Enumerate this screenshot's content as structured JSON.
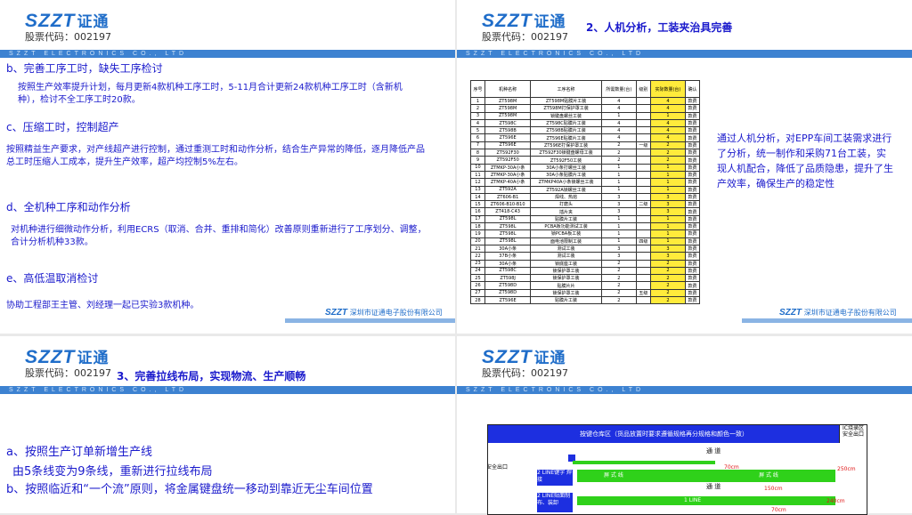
{
  "logo_text": "SZZT",
  "logo_cn": "证通",
  "stock_code": "股票代码：002197",
  "band_text": "SZZT ELECTRONICS CO., LTD",
  "footer_logo": "SZZT",
  "footer_logo_cn": "深圳市证通电子股份有限公司",
  "slide1": {
    "b_head": "b、完善工序工时，缺失工序检讨",
    "b_body": "按照生产效率提升计划，每月更新4款机种工序工时，5-11月合计更新24款机种工序工时（含新机种），检讨不全工序工时20款。",
    "c_head": "c、压缩工时，控制超产",
    "c_body": "按照精益生产要求，对产线超产进行控制，通过重测工时和动作分析，结合生产异常的降低，逐月降低产品总工时压缩人工成本，提升生产效率，超产均控制5%左右。",
    "d_head": "d、全机种工序和动作分析",
    "d_body": "对机种进行细微动作分析，利用ECRS（取消、合并、重排和简化）改善原则重新进行了工序划分、调整，合计分析机种33款。",
    "e_head": "e、高低温取消检讨",
    "e_body": "协助工程部王主管、刘经理一起已实验3款机种。"
  },
  "slide2": {
    "title": "2、人机分析，工装夹治具完善",
    "summary": "通过人机分析，对EPP车间工装需求进行了分析，统一制作和采购71台工装，实现人机配合，降低了品质隐患，提升了生产效率，确保生产的稳定性",
    "table_headers": [
      "序号",
      "机种名称",
      "工序名称",
      "所需数量(台)",
      "级别",
      "实际数量(台)",
      "确认"
    ],
    "rows": [
      [
        "1",
        "ZT598M",
        "ZT598M贴膜片工装",
        "4",
        "",
        "4",
        "款费"
      ],
      [
        "2",
        "ZT598M",
        "ZT598M打保护罩工装",
        "4",
        "",
        "4",
        "款费"
      ],
      [
        "3",
        "ZT598M",
        "锁键盘螺丝工装",
        "1",
        "",
        "1",
        "款费"
      ],
      [
        "4",
        "ZT598C",
        "ZT598C贴膜片工装",
        "4",
        "",
        "4",
        "款费"
      ],
      [
        "5",
        "ZT598B",
        "ZT598B贴膜片工装",
        "4",
        "",
        "4",
        "款费"
      ],
      [
        "6",
        "ZT596E",
        "ZT596E贴膜片工装",
        "4",
        "",
        "4",
        "款费"
      ],
      [
        "7",
        "ZT596E",
        "ZT596E打保护罩工装",
        "2",
        "一级",
        "2",
        "款费"
      ],
      [
        "8",
        "ZT592F30",
        "ZT592F30锁键盘螺母工装",
        "2",
        "",
        "2",
        "款费"
      ],
      [
        "9",
        "ZT592F50",
        "ZT592F50工装",
        "2",
        "",
        "2",
        "款费"
      ],
      [
        "10",
        "ZTMKP-30A小条",
        "30A小条打螺丝工装",
        "1",
        "",
        "1",
        "款费"
      ],
      [
        "11",
        "ZTMKP-30A小条",
        "30A小条贴膜片工装",
        "1",
        "",
        "1",
        "款费"
      ],
      [
        "12",
        "ZTMKP-40A小条",
        "ZTMKP40A小条锁螺丝工装",
        "1",
        "",
        "1",
        "款费"
      ],
      [
        "13",
        "ZT592A",
        "ZT592A锁螺丝工装",
        "1",
        "",
        "1",
        "款费"
      ],
      [
        "14",
        "ZT606-B1",
        "焊线、热熔",
        "3",
        "",
        "3",
        "款费"
      ],
      [
        "15",
        "ZT606-B10-B10",
        "打磨头",
        "3",
        "二级",
        "3",
        "款费"
      ],
      [
        "16",
        "ZT418-C43",
        "插片夹",
        "3",
        "",
        "3",
        "款费"
      ],
      [
        "17",
        "ZT598L",
        "贴膜片工装",
        "1",
        "",
        "1",
        "款费"
      ],
      [
        "18",
        "ZT598L",
        "PCBA板功能测试工装",
        "1",
        "",
        "1",
        "款费"
      ],
      [
        "19",
        "ZT598L",
        "锁PCBA板工装",
        "1",
        "",
        "1",
        "款费"
      ],
      [
        "20",
        "ZT598L",
        "面电池限制工装",
        "1",
        "四级",
        "1",
        "款费"
      ],
      [
        "21",
        "30A小条",
        "测试工装",
        "3",
        "",
        "3",
        "款费"
      ],
      [
        "22",
        "37B小条",
        "测试工装",
        "3",
        "",
        "3",
        "款费"
      ],
      [
        "23",
        "30A小条",
        "锁底座工装",
        "2",
        "",
        "2",
        "款费"
      ],
      [
        "24",
        "ZT598C",
        "锁保护罩工装",
        "2",
        "",
        "2",
        "款费"
      ],
      [
        "25",
        "ZT598J",
        "锁保护罩工装",
        "2",
        "",
        "2",
        "款费"
      ],
      [
        "26",
        "ZT598D",
        "贴膜片片",
        "2",
        "",
        "2",
        "款费"
      ],
      [
        "27",
        "ZT598D",
        "锁保护罩工装",
        "2",
        "五级",
        "2",
        "款费"
      ],
      [
        "28",
        "ZT596E",
        "贴膜片工装",
        "2",
        "",
        "2",
        "款费"
      ]
    ]
  },
  "slide3": {
    "title": "3、完善拉线布局，实现物流、生产顺畅",
    "a_head": "a、按照生产订单新增生产线",
    "a_body": "由5条线变为9条线，重新进行拉线布局",
    "b_head": "b、按照临近和“一个流”原则，将金属键盘统一移动到靠近无尘车间位置"
  },
  "slide4": {
    "top_banner": "按键仓库区（货品放置时要求遵循规格再分规格和颜色一致）",
    "exit_top": "安全出口",
    "exit_left": "安全出口",
    "aisle1": "通    道",
    "aisle2": "通    道",
    "line_a": "屏 式 线",
    "line_b": "屏 式 线",
    "line_c": "1 LINE",
    "left_box1": "2 LINE键字 焊接",
    "left_box2": "2 LINE贴面制 布、装卸",
    "dim1": "70cm",
    "dim2": "150cm",
    "dim3": "70cm",
    "dim4": "240cm",
    "dim5": "250cm",
    "ic_label": "IC烧录区"
  }
}
